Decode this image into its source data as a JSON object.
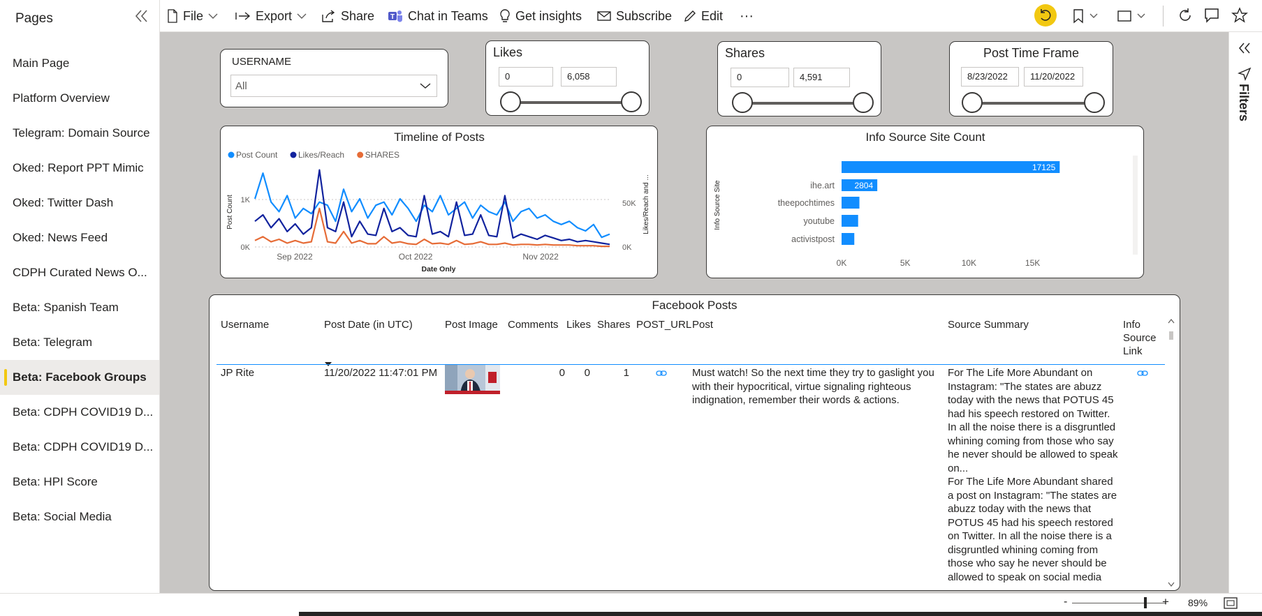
{
  "pages_pane": {
    "title": "Pages",
    "items": [
      {
        "label": "Main Page",
        "active": false
      },
      {
        "label": "Platform Overview",
        "active": false
      },
      {
        "label": "Telegram: Domain Source",
        "active": false
      },
      {
        "label": "Oked: Report PPT Mimic",
        "active": false
      },
      {
        "label": "Oked: Twitter Dash",
        "active": false
      },
      {
        "label": "Oked: News Feed",
        "active": false
      },
      {
        "label": "CDPH Curated News O...",
        "active": false
      },
      {
        "label": "Beta: Spanish Team",
        "active": false
      },
      {
        "label": "Beta: Telegram",
        "active": false
      },
      {
        "label": "Beta: Facebook Groups",
        "active": true
      },
      {
        "label": "Beta: CDPH COVID19 D...",
        "active": false
      },
      {
        "label": "Beta: CDPH COVID19 D...",
        "active": false
      },
      {
        "label": "Beta: HPI Score",
        "active": false
      },
      {
        "label": "Beta: Social Media",
        "active": false
      }
    ]
  },
  "toolbar": {
    "file": "File",
    "export": "Export",
    "share": "Share",
    "chat_in_teams": "Chat in Teams",
    "get_insights": "Get insights",
    "subscribe": "Subscribe",
    "edit": "Edit",
    "more": "···"
  },
  "filters_pane": {
    "label": "Filters"
  },
  "slicers": {
    "username": {
      "title": "USERNAME",
      "value": "All"
    },
    "likes": {
      "title": "Likes",
      "min": "0",
      "max": "6,058"
    },
    "shares": {
      "title": "Shares",
      "min": "0",
      "max": "4,591"
    },
    "post_time_frame": {
      "title": "Post Time Frame",
      "start": "8/23/2022",
      "end": "11/20/2022"
    }
  },
  "timeline": {
    "title": "Timeline of Posts",
    "legend": [
      "Post Count",
      "Likes/Reach",
      "SHARES"
    ],
    "colors": {
      "post_count": "#118dff",
      "likes_reach": "#12239e",
      "shares": "#e66c37"
    },
    "y_left_label": "Post Count",
    "y_right_label": "Likes/Reach and ...",
    "x_label": "Date Only",
    "y_left_ticks": [
      "1K",
      "0K"
    ],
    "y_right_ticks": [
      "50K",
      "0K"
    ],
    "x_ticks": [
      "Sep 2022",
      "Oct 2022",
      "Nov 2022"
    ]
  },
  "chart_data": [
    {
      "type": "line",
      "title": "Timeline of Posts",
      "xlabel": "Date Only",
      "ylabel": "Post Count",
      "y2label": "Likes/Reach and ...",
      "x": [
        "2022-08-23",
        "2022-08-25",
        "2022-08-27",
        "2022-08-29",
        "2022-08-31",
        "2022-09-02",
        "2022-09-04",
        "2022-09-06",
        "2022-09-08",
        "2022-09-10",
        "2022-09-12",
        "2022-09-14",
        "2022-09-16",
        "2022-09-18",
        "2022-09-20",
        "2022-09-22",
        "2022-09-24",
        "2022-09-26",
        "2022-09-28",
        "2022-09-30",
        "2022-10-02",
        "2022-10-04",
        "2022-10-06",
        "2022-10-08",
        "2022-10-10",
        "2022-10-12",
        "2022-10-14",
        "2022-10-16",
        "2022-10-18",
        "2022-10-20",
        "2022-10-22",
        "2022-10-24",
        "2022-10-26",
        "2022-10-28",
        "2022-10-30",
        "2022-11-01",
        "2022-11-03",
        "2022-11-05",
        "2022-11-07",
        "2022-11-09",
        "2022-11-11",
        "2022-11-13",
        "2022-11-15",
        "2022-11-17",
        "2022-11-19"
      ],
      "series": [
        {
          "name": "Post Count",
          "axis": "left",
          "values": [
            750,
            1150,
            700,
            550,
            800,
            450,
            600,
            520,
            700,
            650,
            400,
            900,
            550,
            750,
            450,
            650,
            700,
            500,
            750,
            600,
            400,
            650,
            550,
            800,
            500,
            600,
            700,
            450,
            650,
            550,
            500,
            700,
            400,
            550,
            600,
            450,
            500,
            400,
            350,
            400,
            300,
            250,
            350,
            150,
            200
          ]
        },
        {
          "name": "Likes/Reach",
          "axis": "right",
          "values": [
            20000,
            25000,
            15000,
            22000,
            12000,
            18000,
            10000,
            15000,
            60000,
            15000,
            12000,
            35000,
            8000,
            20000,
            10000,
            9000,
            30000,
            12000,
            15000,
            9000,
            8000,
            40000,
            10000,
            12000,
            8000,
            35000,
            9000,
            10000,
            25000,
            9000,
            8000,
            40000,
            7000,
            10000,
            8000,
            6000,
            9000,
            7000,
            5000,
            6000,
            4000,
            5000,
            4000,
            3000,
            2000
          ]
        },
        {
          "name": "SHARES",
          "axis": "right",
          "values": [
            5000,
            8000,
            4000,
            6000,
            3000,
            5000,
            3000,
            4000,
            30000,
            4000,
            3000,
            12000,
            3000,
            5000,
            2500,
            2500,
            8000,
            3000,
            4000,
            2500,
            2000,
            6000,
            2500,
            3000,
            2000,
            5000,
            2000,
            2500,
            4000,
            2000,
            2000,
            3000,
            1500,
            2000,
            2000,
            1500,
            2000,
            1500,
            1500,
            1500,
            1000,
            1000,
            1000,
            500,
            500
          ]
        }
      ],
      "y_left_range": [
        0,
        1250
      ],
      "y_right_range": [
        0,
        62500
      ]
    },
    {
      "type": "bar",
      "title": "Info Source Site Count",
      "ylabel": "Info Source Site",
      "categories": [
        "",
        "ihe.art",
        "theepochtimes",
        "youtube",
        "activistpost"
      ],
      "values": [
        17125,
        2804,
        1400,
        1300,
        1000
      ],
      "data_labels": [
        "17125",
        "2804",
        "",
        "",
        ""
      ],
      "x_ticks": [
        "0K",
        "5K",
        "10K",
        "15K"
      ],
      "xlim": [
        0,
        18000
      ],
      "orientation": "horizontal",
      "color": "#118dff"
    }
  ],
  "info_source": {
    "title": "Info Source Site Count",
    "y_label": "Info Source Site"
  },
  "table": {
    "title": "Facebook Posts",
    "columns": [
      "Username",
      "Post Date (in UTC)",
      "Post Image",
      "Comments",
      "Likes",
      "Shares",
      "POST_URL",
      "Post",
      "Source Summary",
      "Info Source Link"
    ],
    "row": {
      "username": "JP Rite",
      "post_date": "11/20/2022 11:47:01 PM",
      "comments": "0",
      "likes": "0",
      "shares": "1",
      "post_lines": [
        "Must watch! So the next time they try to gaslight you",
        "with their hypocritical, virtue signaling righteous",
        "indignation, remember their words & actions."
      ],
      "summary_lines": [
        "For The Life More Abundant on",
        "Instagram: \"The states are abuzz",
        "today with the news that POTUS 45",
        "had his speech restored on Twitter.",
        "In all the noise there is a disgruntled",
        "whining coming from those who say",
        "he never should be allowed to speak",
        "on...",
        "For The Life More Abundant shared",
        "a post on Instagram: \"The states are",
        "abuzz today with the news that",
        "POTUS 45 had his speech restored",
        "on Twitter. In all the noise there is a",
        "disgruntled whining coming from",
        "those who say he never should be",
        "allowed to speak on social media"
      ]
    }
  },
  "status": {
    "zoom": "89%",
    "zoom_level": 0.89
  }
}
